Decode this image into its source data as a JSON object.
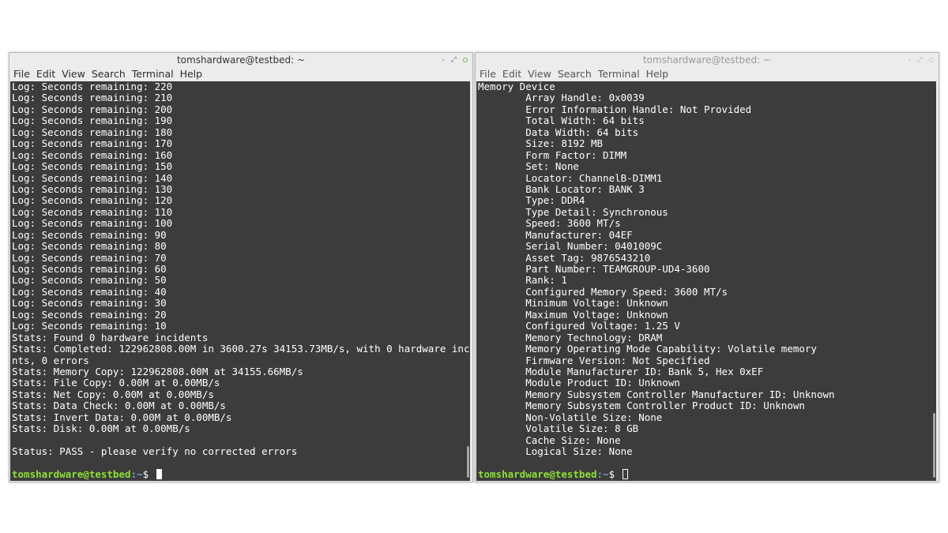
{
  "left_window": {
    "title": "tomshardware@testbed: ~",
    "menu": [
      "File",
      "Edit",
      "View",
      "Search",
      "Terminal",
      "Help"
    ],
    "lines": [
      "Log: Seconds remaining: 220",
      "Log: Seconds remaining: 210",
      "Log: Seconds remaining: 200",
      "Log: Seconds remaining: 190",
      "Log: Seconds remaining: 180",
      "Log: Seconds remaining: 170",
      "Log: Seconds remaining: 160",
      "Log: Seconds remaining: 150",
      "Log: Seconds remaining: 140",
      "Log: Seconds remaining: 130",
      "Log: Seconds remaining: 120",
      "Log: Seconds remaining: 110",
      "Log: Seconds remaining: 100",
      "Log: Seconds remaining: 90",
      "Log: Seconds remaining: 80",
      "Log: Seconds remaining: 70",
      "Log: Seconds remaining: 60",
      "Log: Seconds remaining: 50",
      "Log: Seconds remaining: 40",
      "Log: Seconds remaining: 30",
      "Log: Seconds remaining: 20",
      "Log: Seconds remaining: 10",
      "Stats: Found 0 hardware incidents",
      "Stats: Completed: 122962808.00M in 3600.27s 34153.73MB/s, with 0 hardware incide",
      "nts, 0 errors",
      "Stats: Memory Copy: 122962808.00M at 34155.66MB/s",
      "Stats: File Copy: 0.00M at 0.00MB/s",
      "Stats: Net Copy: 0.00M at 0.00MB/s",
      "Stats: Data Check: 0.00M at 0.00MB/s",
      "Stats: Invert Data: 0.00M at 0.00MB/s",
      "Stats: Disk: 0.00M at 0.00MB/s",
      "",
      "Status: PASS - please verify no corrected errors"
    ],
    "prompt_user": "tomshardware@testbed",
    "prompt_path": ":~",
    "prompt_symbol": "$ "
  },
  "right_window": {
    "title": "tomshardware@testbed: ~",
    "menu": [
      "File",
      "Edit",
      "View",
      "Search",
      "Terminal",
      "Help"
    ],
    "lines": [
      "Memory Device",
      "        Array Handle: 0x0039",
      "        Error Information Handle: Not Provided",
      "        Total Width: 64 bits",
      "        Data Width: 64 bits",
      "        Size: 8192 MB",
      "        Form Factor: DIMM",
      "        Set: None",
      "        Locator: ChannelB-DIMM1",
      "        Bank Locator: BANK 3",
      "        Type: DDR4",
      "        Type Detail: Synchronous",
      "        Speed: 3600 MT/s",
      "        Manufacturer: 04EF",
      "        Serial Number: 0401009C",
      "        Asset Tag: 9876543210",
      "        Part Number: TEAMGROUP-UD4-3600",
      "        Rank: 1",
      "        Configured Memory Speed: 3600 MT/s",
      "        Minimum Voltage: Unknown",
      "        Maximum Voltage: Unknown",
      "        Configured Voltage: 1.25 V",
      "        Memory Technology: DRAM",
      "        Memory Operating Mode Capability: Volatile memory",
      "        Firmware Version: Not Specified",
      "        Module Manufacturer ID: Bank 5, Hex 0xEF",
      "        Module Product ID: Unknown",
      "        Memory Subsystem Controller Manufacturer ID: Unknown",
      "        Memory Subsystem Controller Product ID: Unknown",
      "        Non-Volatile Size: None",
      "        Volatile Size: 8 GB",
      "        Cache Size: None",
      "        Logical Size: None"
    ],
    "prompt_user": "tomshardware@testbed",
    "prompt_path": ":~",
    "prompt_symbol": "$ "
  },
  "window_controls": {
    "minimize": "-",
    "maximize": "⤢"
  }
}
